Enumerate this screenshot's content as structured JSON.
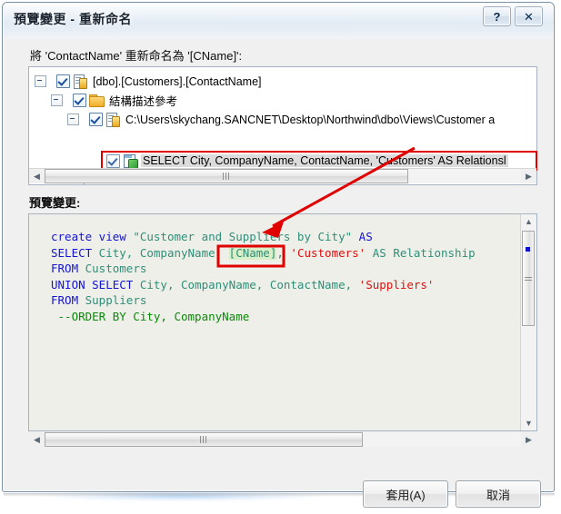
{
  "window": {
    "title": "預覽變更 - 重新命名",
    "help_glyph": "?",
    "close_glyph": "✕"
  },
  "instruction": "將 'ContactName' 重新命名為 '[CName]':",
  "tree": {
    "nodes": [
      {
        "label": "[dbo].[Customers].[ContactName]",
        "icon": "document-icon",
        "checked": true,
        "expanded": true
      },
      {
        "label": "結構描述參考",
        "icon": "folder-icon",
        "checked": true,
        "expanded": true
      },
      {
        "label": "C:\\Users\\skychang.SANCNET\\Desktop\\Northwind\\dbo\\Views\\Customer a",
        "icon": "document-icon",
        "checked": true,
        "expanded": true
      },
      {
        "label": "SELECT City, CompanyName, ContactName, 'Customers' AS Relationsl",
        "icon": "view-icon",
        "checked": true,
        "expanded": false
      }
    ]
  },
  "preview_label": "預覽變更:",
  "code": {
    "lines": [
      [
        {
          "t": "create view ",
          "c": "kw"
        },
        {
          "t": "\"Customer and Suppliers by City\"",
          "c": "id"
        },
        {
          "t": " AS",
          "c": "kw"
        }
      ],
      [
        {
          "t": "SELECT",
          "c": "kw"
        },
        {
          "t": " City, CompanyName, ",
          "c": "id"
        },
        {
          "t": "[CName]",
          "c": "id hl"
        },
        {
          "t": ", ",
          "c": "id"
        },
        {
          "t": "'Customers'",
          "c": "lit"
        },
        {
          "t": " AS Relationship",
          "c": "id"
        }
      ],
      [
        {
          "t": "FROM",
          "c": "kw"
        },
        {
          "t": " Customers",
          "c": "id"
        }
      ],
      [
        {
          "t": "UNION SELECT",
          "c": "kw"
        },
        {
          "t": " City, CompanyName, ContactName, ",
          "c": "id"
        },
        {
          "t": "'Suppliers'",
          "c": "lit"
        }
      ],
      [
        {
          "t": "FROM",
          "c": "kw"
        },
        {
          "t": " Suppliers",
          "c": "id"
        }
      ],
      [
        {
          "t": " --ORDER BY City, CompanyName",
          "c": "cmt"
        }
      ]
    ]
  },
  "scrollbars": {
    "left_arrow": "◀",
    "right_arrow": "▶",
    "up_arrow": "▲",
    "down_arrow": "▼"
  },
  "buttons": {
    "apply": "套用(A)",
    "cancel": "取消"
  },
  "annotation": {
    "highlight_color": "#e00000",
    "arrow_color": "#e00000"
  }
}
